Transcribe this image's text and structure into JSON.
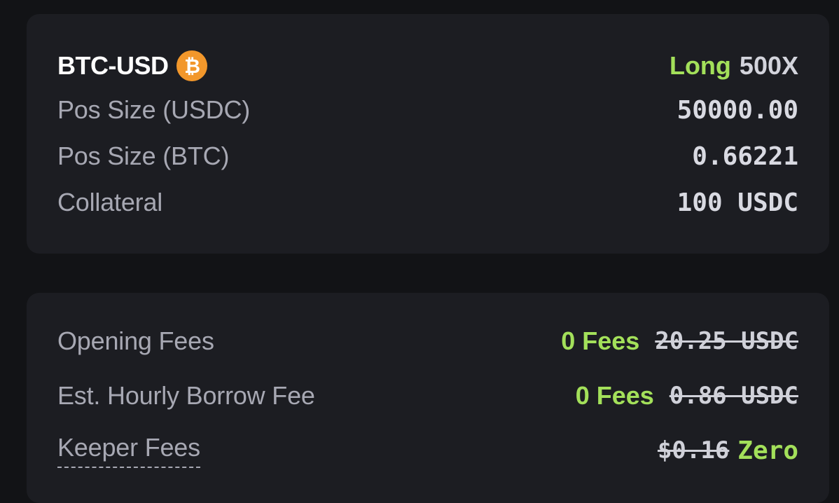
{
  "position": {
    "pair": "BTC-USD",
    "coin_icon": "bitcoin-icon",
    "coin_symbol": "₿",
    "direction": "Long",
    "leverage": "500X",
    "rows": [
      {
        "label": "Pos Size (USDC)",
        "value": "50000.00"
      },
      {
        "label": "Pos Size (BTC)",
        "value": "0.66221"
      },
      {
        "label": "Collateral",
        "value": "100 USDC"
      }
    ]
  },
  "fees": {
    "opening": {
      "label": "Opening Fees",
      "free_text": "0 Fees",
      "original": "20.25 USDC"
    },
    "borrow": {
      "label": "Est. Hourly Borrow Fee",
      "free_text": "0 Fees",
      "original": "0.86 USDC"
    },
    "keeper": {
      "label": "Keeper Fees",
      "original": "$0.16",
      "free_text": "Zero"
    }
  },
  "colors": {
    "background": "#121316",
    "card": "#1c1d22",
    "accent_green": "#a3e05a",
    "bitcoin_orange": "#f2972b"
  }
}
